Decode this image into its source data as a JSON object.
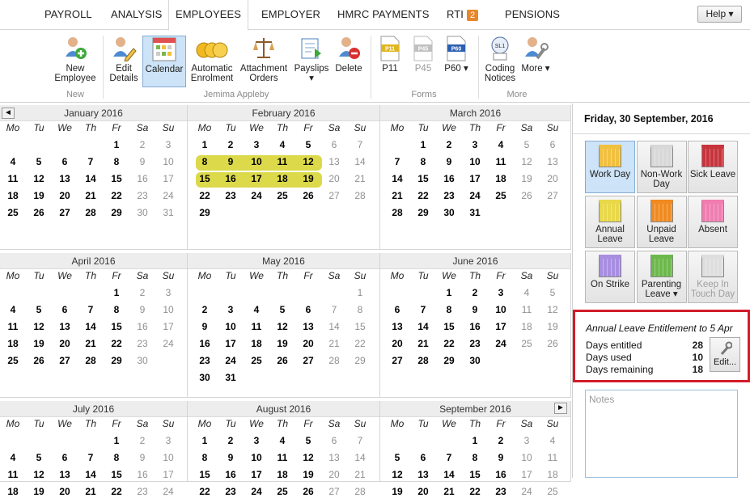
{
  "tabs": {
    "payroll": "PAYROLL",
    "analysis": "ANALYSIS",
    "employees": "EMPLOYEES",
    "employer": "EMPLOYER",
    "hmrc": "HMRC PAYMENTS",
    "rti": "RTI",
    "rti_badge": "2",
    "pensions": "PENSIONS",
    "help": "Help ▾"
  },
  "ribbon": {
    "new_employee": "New Employee",
    "edit_details": "Edit Details",
    "calendar": "Calendar",
    "auto_enrol": "Automatic Enrolment",
    "attachment": "Attachment Orders",
    "payslips": "Payslips ▾",
    "delete": "Delete",
    "p11": "P11",
    "p45": "P45",
    "p60": "P60 ▾",
    "coding": "Coding Notices",
    "more": "More ▾",
    "grp_new": "New",
    "grp_emp": "Jemima Appleby",
    "grp_forms": "Forms",
    "grp_more": "More",
    "p11_tag": "P11",
    "p45_tag": "P45",
    "p60_tag": "P60",
    "coding_tag": "SL1"
  },
  "weekdays": [
    "Mo",
    "Tu",
    "We",
    "Th",
    "Fr",
    "Sa",
    "Su"
  ],
  "months": [
    {
      "title": "January 2016",
      "offset": 4,
      "days": 31,
      "highlight": []
    },
    {
      "title": "February 2016",
      "offset": 0,
      "days": 29,
      "highlight": [
        8,
        9,
        10,
        11,
        12,
        15,
        16,
        17,
        18,
        19
      ]
    },
    {
      "title": "March 2016",
      "offset": 1,
      "days": 31,
      "highlight": []
    },
    {
      "title": "April 2016",
      "offset": 4,
      "days": 30,
      "highlight": []
    },
    {
      "title": "May 2016",
      "offset": 6,
      "days": 31,
      "highlight": []
    },
    {
      "title": "June 2016",
      "offset": 2,
      "days": 30,
      "highlight": []
    },
    {
      "title": "July 2016",
      "offset": 4,
      "days": 31,
      "highlight": []
    },
    {
      "title": "August 2016",
      "offset": 0,
      "days": 31,
      "highlight": []
    },
    {
      "title": "September 2016",
      "offset": 3,
      "days": 30,
      "highlight": []
    }
  ],
  "nav": {
    "prev": "◄",
    "next": "►"
  },
  "panel": {
    "date": "Friday, 30 September, 2016",
    "types": [
      {
        "label": "Work Day",
        "color": "#f0c040"
      },
      {
        "label": "Non-Work Day",
        "color": "#d8d8d8"
      },
      {
        "label": "Sick Leave",
        "color": "#c8343c"
      },
      {
        "label": "Annual Leave",
        "color": "#e8d84a"
      },
      {
        "label": "Unpaid Leave",
        "color": "#f08a20"
      },
      {
        "label": "Absent",
        "color": "#f07cb0"
      },
      {
        "label": "On Strike",
        "color": "#a88ee0"
      },
      {
        "label": "Parenting Leave ▾",
        "color": "#6cb84a"
      },
      {
        "label": "Keep In Touch Day",
        "color": "#dedede"
      }
    ],
    "ent_title": "Annual Leave Entitlement to 5 Apr",
    "entitled_label": "Days entitled",
    "entitled": "28",
    "used_label": "Days used",
    "used": "10",
    "remaining_label": "Days remaining",
    "remaining": "18",
    "edit": "Edit...",
    "notes": "Notes"
  }
}
